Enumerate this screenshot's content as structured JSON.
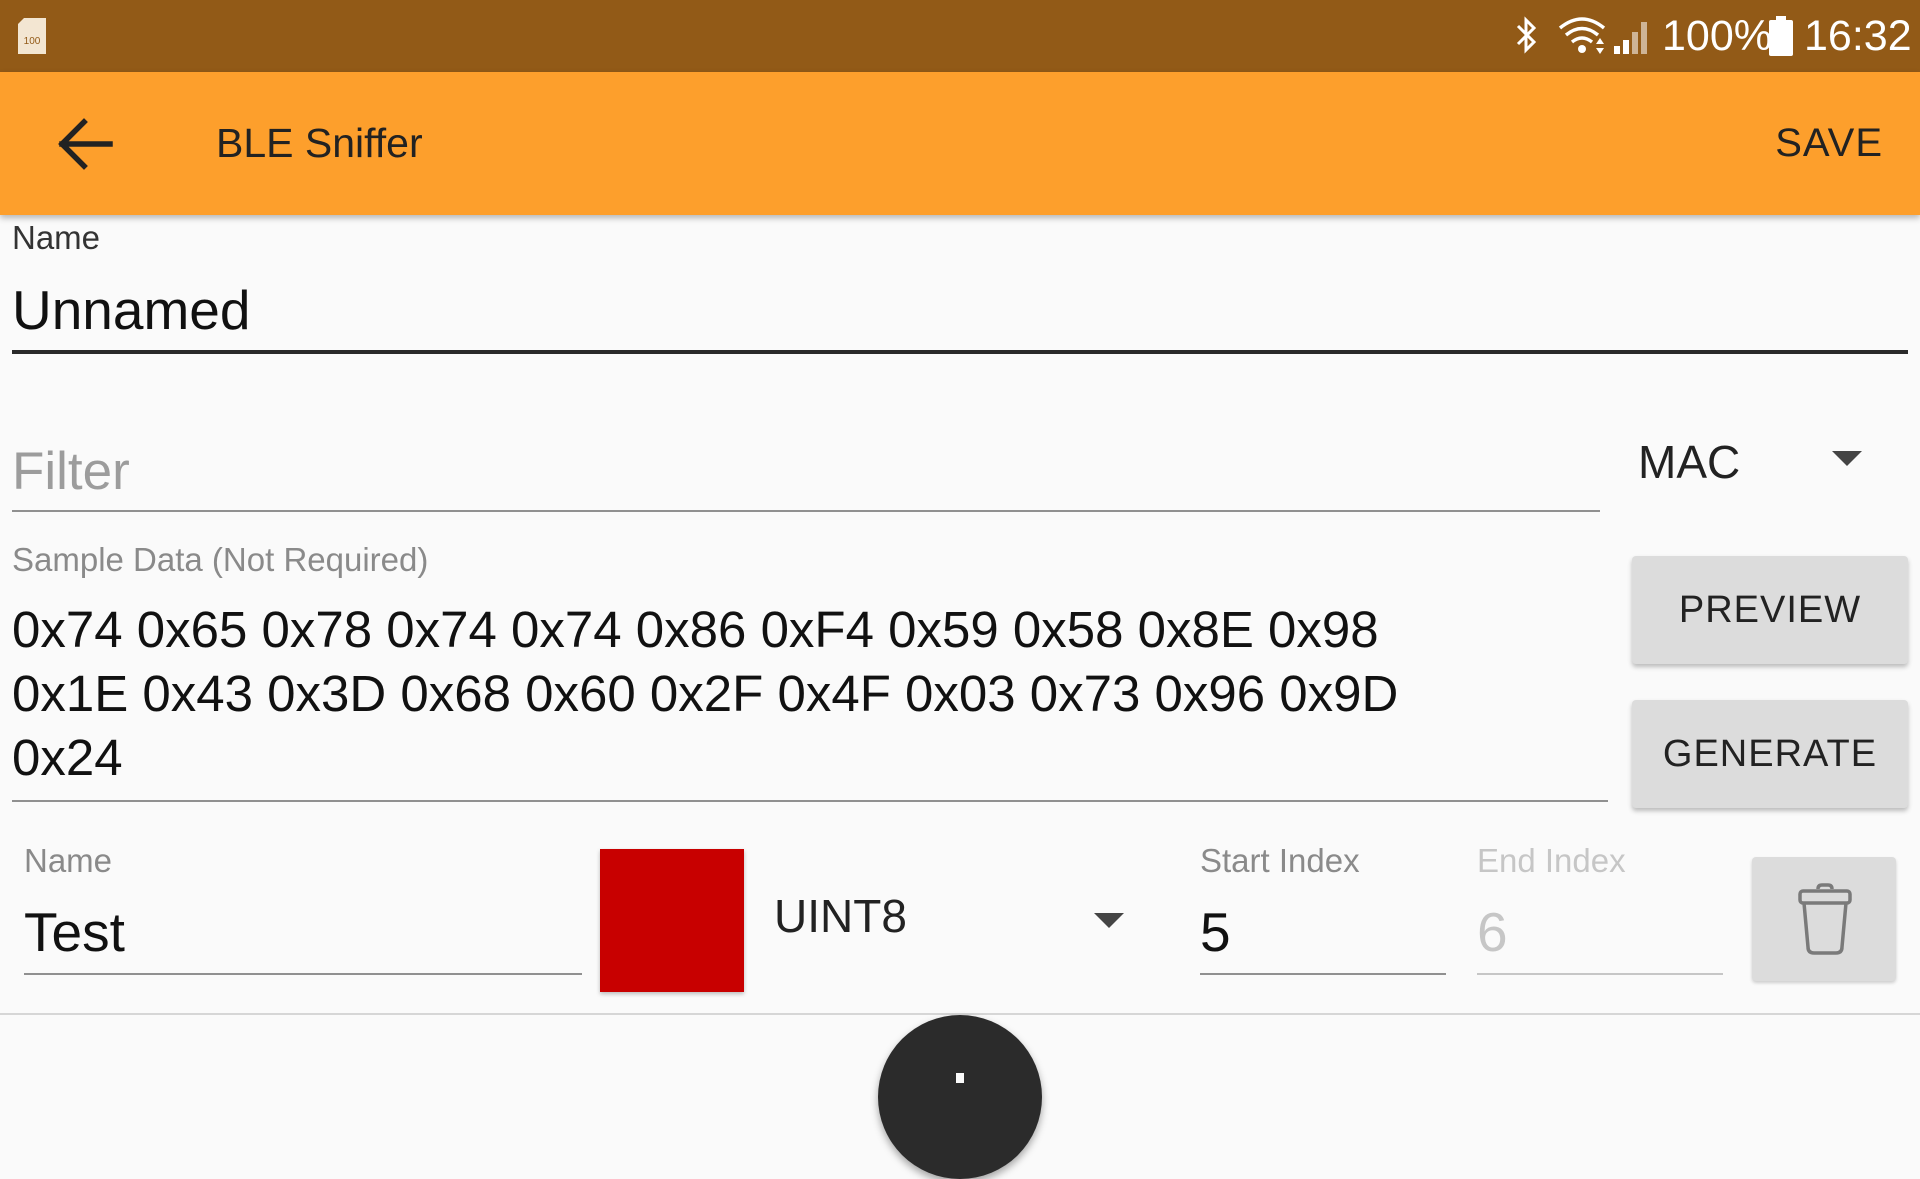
{
  "status_bar": {
    "sd_icon_text": "100",
    "battery_percent": "100%",
    "time": "16:32",
    "icons": [
      "sd-card-icon",
      "bluetooth-icon",
      "wifi-icon",
      "signal-icon",
      "battery-icon"
    ]
  },
  "app_bar": {
    "title": "BLE Sniffer",
    "save_label": "SAVE",
    "back_icon": "arrow-back-icon"
  },
  "form": {
    "name_label": "Name",
    "name_value": "Unnamed",
    "filter_placeholder": "Filter",
    "filter_type": "MAC",
    "sample_label": "Sample Data (Not Required)",
    "sample_lines": [
      "0x74 0x65 0x78 0x74 0x74 0x86 0xF4 0x59 0x58 0x8E 0x98",
      "0x1E 0x43 0x3D 0x68 0x60 0x2F 0x4F 0x03 0x73 0x96 0x9D",
      "0x24"
    ],
    "preview_label": "PREVIEW",
    "generate_label": "GENERATE"
  },
  "field_row": {
    "name_label": "Name",
    "name_value": "Test",
    "color": "#c80000",
    "type_value": "UINT8",
    "start_label": "Start Index",
    "start_value": "5",
    "end_label": "End Index",
    "end_value": "6",
    "delete_icon": "trash-icon"
  },
  "fab_icon": "plus-icon",
  "colors": {
    "status_bar": "#925a17",
    "app_bar": "#fd9f2c",
    "swatch": "#c80000"
  }
}
